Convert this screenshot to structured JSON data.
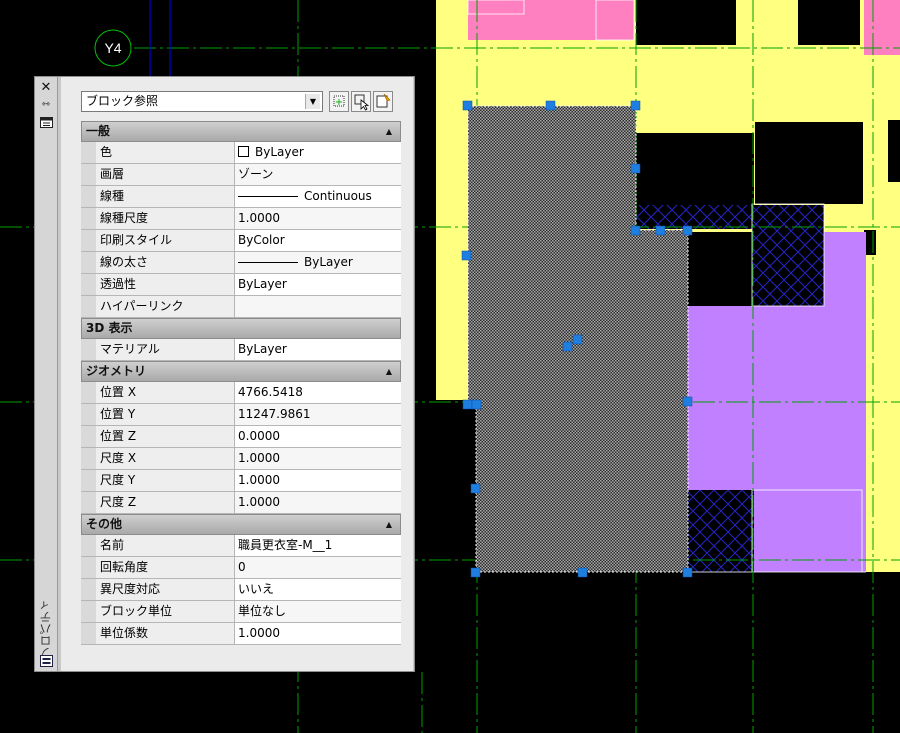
{
  "drawing": {
    "grid_bubble_label": "Y4"
  },
  "palette": {
    "vertical_title": "プロパティ",
    "icons": {
      "close": "close-icon",
      "autohide": "autohide-icon",
      "menu": "properties-menu-icon",
      "bottom": "palette-settings-icon"
    },
    "selector_value": "ブロック参照",
    "tool_icons": [
      "toggle-pickadd-icon",
      "select-objects-icon",
      "quick-select-icon"
    ],
    "sections": [
      {
        "title": "一般",
        "rows": [
          {
            "name": "色",
            "value": "ByLayer",
            "kind": "swatch"
          },
          {
            "name": "画層",
            "value": "ゾーン"
          },
          {
            "name": "線種",
            "value": "Continuous",
            "kind": "line"
          },
          {
            "name": "線種尺度",
            "value": "1.0000"
          },
          {
            "name": "印刷スタイル",
            "value": "ByColor"
          },
          {
            "name": "線の太さ",
            "value": "ByLayer",
            "kind": "line"
          },
          {
            "name": "透過性",
            "value": "ByLayer"
          },
          {
            "name": "ハイパーリンク",
            "value": ""
          }
        ]
      },
      {
        "title": "3D 表示",
        "rows": [
          {
            "name": "マテリアル",
            "value": "ByLayer"
          }
        ]
      },
      {
        "title": "ジオメトリ",
        "rows": [
          {
            "name": "位置 X",
            "value": "4766.5418"
          },
          {
            "name": "位置 Y",
            "value": "11247.9861"
          },
          {
            "name": "位置 Z",
            "value": "0.0000"
          },
          {
            "name": "尺度 X",
            "value": "1.0000"
          },
          {
            "name": "尺度 Y",
            "value": "1.0000"
          },
          {
            "name": "尺度 Z",
            "value": "1.0000"
          }
        ]
      },
      {
        "title": "その他",
        "rows": [
          {
            "name": "名前",
            "value": "職員更衣室-M__1"
          },
          {
            "name": "回転角度",
            "value": "0"
          },
          {
            "name": "異尺度対応",
            "value": "いいえ"
          },
          {
            "name": "ブロック単位",
            "value": "単位なし"
          },
          {
            "name": "単位係数",
            "value": "1.0000"
          }
        ]
      }
    ]
  },
  "colors": {
    "zone_yellow": "#ffff80",
    "zone_pink": "#ff80c0",
    "zone_purple": "#c080ff",
    "grid_line": "#00a000",
    "axis_blue": "#0000ff",
    "grip_blue": "#1e7fe0",
    "hatch_blue": "#2020c0"
  }
}
